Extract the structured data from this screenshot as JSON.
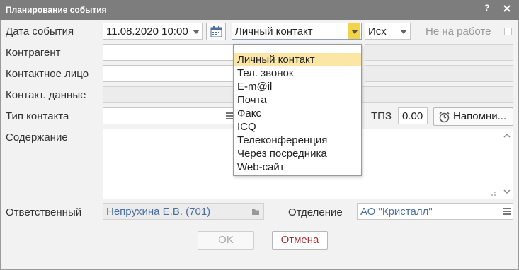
{
  "window": {
    "title": "Планирование события",
    "help": "?"
  },
  "event_date": {
    "label": "Дата события",
    "value": "11.08.2020 10:00"
  },
  "contact_mode": {
    "value": "Личный контакт"
  },
  "direction": {
    "value": "Исх"
  },
  "not_at_work": {
    "label": "Не на работе",
    "checked": false
  },
  "contractor": {
    "label": "Контрагент",
    "value": ""
  },
  "contact_person": {
    "label": "Контактное лицо",
    "value": ""
  },
  "contact_data": {
    "label": "Контакт. данные",
    "value": ""
  },
  "contact_type": {
    "label": "Тип контакта",
    "value": ""
  },
  "tpz": {
    "label": "ТПЗ",
    "value": "0.00"
  },
  "remind_button": {
    "label": "Напомни..."
  },
  "content": {
    "label": "Содержание",
    "value": ""
  },
  "responsible": {
    "label": "Ответственный",
    "value": "Непрухина Е.В. (701)"
  },
  "department": {
    "label": "Отделение",
    "value": "АО \"Кристалл\""
  },
  "ok_button": {
    "label": "OK"
  },
  "cancel_button": {
    "label": "Отмена"
  },
  "dropdown": {
    "selected_index": 0,
    "items": [
      "Личный контакт",
      "Тел. звонок",
      "E-m@il",
      "Почта",
      "Факс",
      "ICQ",
      "Телеконференция",
      "Через посредника",
      "Web-сайт"
    ]
  },
  "colors": {
    "titlebar": "#7d7d7d",
    "dropdown_highlight": "#fbe6a6",
    "dropdown_button": "#f3d34a",
    "link_text": "#4a6fa0",
    "cancel_text": "#b03030"
  }
}
